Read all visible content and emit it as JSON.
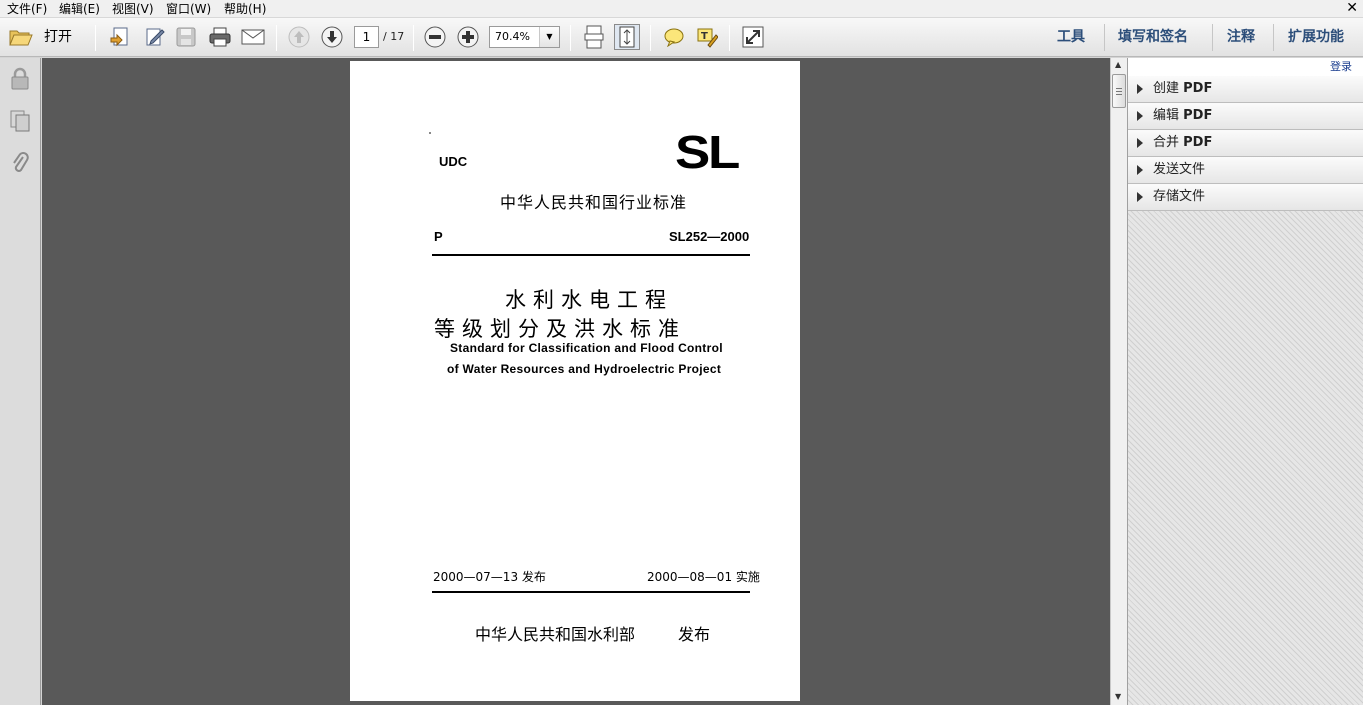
{
  "menu": [
    "文件(F)",
    "编辑(E)",
    "视图(V)",
    "窗口(W)",
    "帮助(H)"
  ],
  "toolbar": {
    "open_label": "打开",
    "page_current": "1",
    "page_total": "/ 17",
    "zoom": "70.4%",
    "right_tabs": [
      "工具",
      "填写和签名",
      "注释",
      "扩展功能"
    ]
  },
  "document": {
    "udc": "UDC",
    "logo": "SL",
    "category": "中华人民共和国行业标准",
    "p_code": "P",
    "standard_no": "SL252—2000",
    "title_cn_1": "水利水电工程",
    "title_cn_2": "等级划分及洪水标准",
    "title_en_1": "Standard for Classification and Flood Control",
    "title_en_2": "of Water Resources and Hydroelectric Project",
    "issue_date": "2000—07—13 发布",
    "effective_date": "2000—08—01 实施",
    "issuer": "中华人民共和国水利部",
    "issuer_action": "发布"
  },
  "right_panel": {
    "login": "登录",
    "sections": [
      {
        "label": "创建 ",
        "suffix": "PDF"
      },
      {
        "label": "编辑 ",
        "suffix": "PDF"
      },
      {
        "label": "合并 ",
        "suffix": "PDF"
      },
      {
        "label": "发送文件",
        "suffix": ""
      },
      {
        "label": "存储文件",
        "suffix": ""
      }
    ]
  }
}
